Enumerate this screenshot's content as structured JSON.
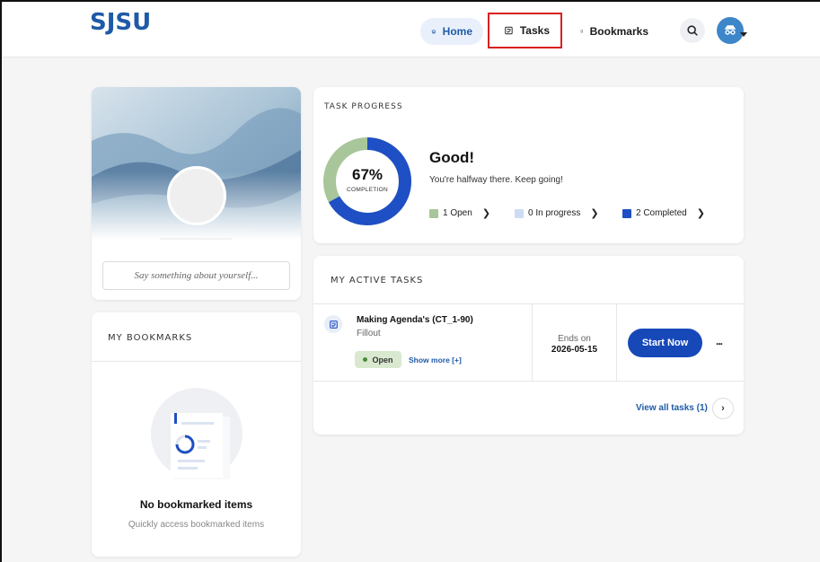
{
  "header": {
    "logo": "SJSU",
    "nav": {
      "home": "Home",
      "tasks": "Tasks",
      "bookmarks": "Bookmarks"
    }
  },
  "profile": {
    "about_placeholder": "Say something about yourself..."
  },
  "bookmarks": {
    "title": "MY BOOKMARKS",
    "empty_title": "No bookmarked items",
    "empty_sub": "Quickly access bookmarked items"
  },
  "task_progress": {
    "title": "TASK PROGRESS",
    "percent": "67%",
    "percent_label": "COMPLETION",
    "completion_fraction": 0.67,
    "heading": "Good!",
    "subtext": "You're halfway there. Keep going!",
    "legend": [
      {
        "label": "1 Open",
        "color": "#a8c69a"
      },
      {
        "label": "0 In progress",
        "color": "#cddcf2"
      },
      {
        "label": "2 Completed",
        "color": "#1f4fc4"
      }
    ]
  },
  "active_tasks": {
    "title": "MY ACTIVE TASKS",
    "task": {
      "name": "Making Agenda's (CT_1-90)",
      "type": "Fillout",
      "status": "Open",
      "show_more": "Show more [+]",
      "ends_label": "Ends on",
      "ends_date": "2026-05-15",
      "start_label": "Start Now",
      "more_label": "..."
    },
    "view_all": "View all tasks (1)"
  },
  "colors": {
    "brand": "#1f5aa6",
    "primary_button": "#1748b8",
    "highlight_border": "#d92020"
  }
}
